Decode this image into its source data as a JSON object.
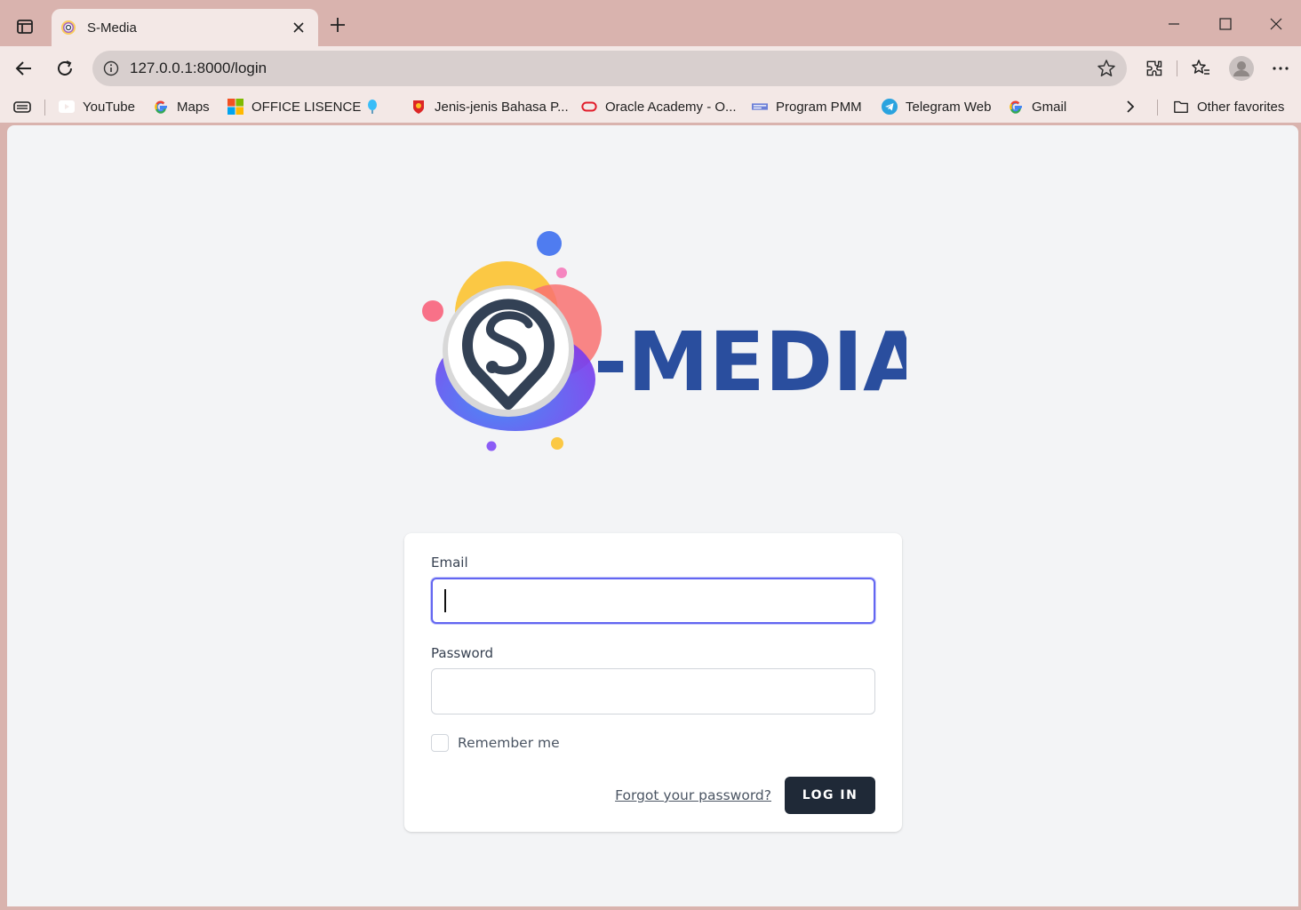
{
  "browser": {
    "tab": {
      "title": "S-Media"
    },
    "address": {
      "url": "127.0.0.1:8000/login"
    },
    "bookmarks": [
      {
        "label": "YouTube",
        "icon": "youtube-icon"
      },
      {
        "label": "Maps",
        "icon": "google-icon"
      },
      {
        "label": "OFFICE LISENCE",
        "icon": "microsoft-icon"
      },
      {
        "label": "",
        "icon": "balloon-icon"
      },
      {
        "label": "Jenis-jenis Bahasa P...",
        "icon": "shield-crest-icon"
      },
      {
        "label": "Oracle Academy - O...",
        "icon": "oracle-icon"
      },
      {
        "label": "Program PMM",
        "icon": "pmm-icon"
      },
      {
        "label": "Telegram Web",
        "icon": "telegram-icon"
      },
      {
        "label": "Gmail",
        "icon": "google-icon"
      }
    ],
    "other_favorites": "Other favorites"
  },
  "logo": {
    "text": "-MEDIA"
  },
  "form": {
    "email_label": "Email",
    "email_value": "",
    "password_label": "Password",
    "password_value": "",
    "remember_label": "Remember me",
    "forgot_link": "Forgot your password?",
    "login_button": "LOG IN"
  },
  "colors": {
    "chrome": "#d9b3ae",
    "toolbar": "#f3e8e6",
    "page_bg": "#f3f4f6",
    "focus_ring": "#6366f1",
    "button": "#1f2937",
    "logo_dark_blue": "#2a4e9e",
    "logo_light_blue": "#0ea5e9"
  }
}
